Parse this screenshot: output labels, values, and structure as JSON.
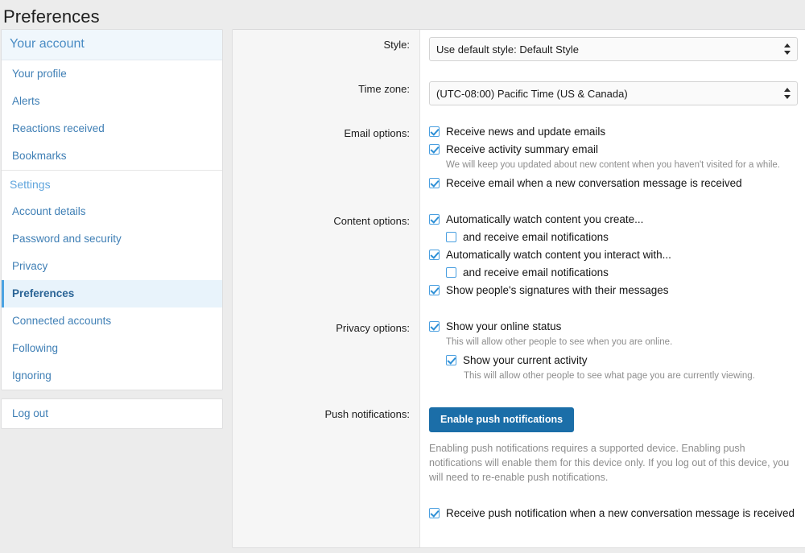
{
  "page": {
    "title": "Preferences"
  },
  "sidebar": {
    "account_header": "Your account",
    "account_items": [
      {
        "label": "Your profile"
      },
      {
        "label": "Alerts"
      },
      {
        "label": "Reactions received"
      },
      {
        "label": "Bookmarks"
      }
    ],
    "settings_header": "Settings",
    "settings_items": [
      {
        "label": "Account details",
        "active": false
      },
      {
        "label": "Password and security",
        "active": false
      },
      {
        "label": "Privacy",
        "active": false
      },
      {
        "label": "Preferences",
        "active": true
      },
      {
        "label": "Connected accounts",
        "active": false
      },
      {
        "label": "Following",
        "active": false
      },
      {
        "label": "Ignoring",
        "active": false
      }
    ],
    "logout_label": "Log out"
  },
  "form": {
    "style": {
      "label": "Style:",
      "value": "Use default style: Default Style",
      "icon": "select-spinner-icon"
    },
    "timezone": {
      "label": "Time zone:",
      "value": "(UTC-08:00) Pacific Time (US & Canada)",
      "icon": "select-spinner-icon"
    },
    "email_options": {
      "label": "Email options:",
      "items": [
        {
          "label": "Receive news and update emails",
          "checked": true,
          "hint": ""
        },
        {
          "label": "Receive activity summary email",
          "checked": true,
          "hint": "We will keep you updated about new content when you haven't visited for a while."
        },
        {
          "label": "Receive email when a new conversation message is received",
          "checked": true,
          "hint": ""
        }
      ]
    },
    "content_options": {
      "label": "Content options:",
      "items": [
        {
          "label": "Automatically watch content you create...",
          "checked": true,
          "indent": false
        },
        {
          "label": "and receive email notifications",
          "checked": false,
          "indent": true
        },
        {
          "label": "Automatically watch content you interact with...",
          "checked": true,
          "indent": false
        },
        {
          "label": "and receive email notifications",
          "checked": false,
          "indent": true
        },
        {
          "label": "Show people's signatures with their messages",
          "checked": true,
          "indent": false
        }
      ]
    },
    "privacy_options": {
      "label": "Privacy options:",
      "items": [
        {
          "label": "Show your online status",
          "checked": true,
          "indent": false,
          "hint": "This will allow other people to see when you are online."
        },
        {
          "label": "Show your current activity",
          "checked": true,
          "indent": true,
          "hint": "This will allow other people to see what page you are currently viewing."
        }
      ]
    },
    "push_notifications": {
      "label": "Push notifications:",
      "button_label": "Enable push notifications",
      "description": "Enabling push notifications requires a supported device. Enabling push notifications will enable them for this device only. If you log out of this device, you will need to re-enable push notifications.",
      "checkbox": {
        "label": "Receive push notification when a new conversation message is received",
        "checked": true
      }
    }
  },
  "colors": {
    "accent": "#1b6ea8",
    "link": "#3f7fb5",
    "active_bg": "#e8f3fb",
    "checkbox_border": "#4a9fe0",
    "page_bg": "#ececec"
  }
}
